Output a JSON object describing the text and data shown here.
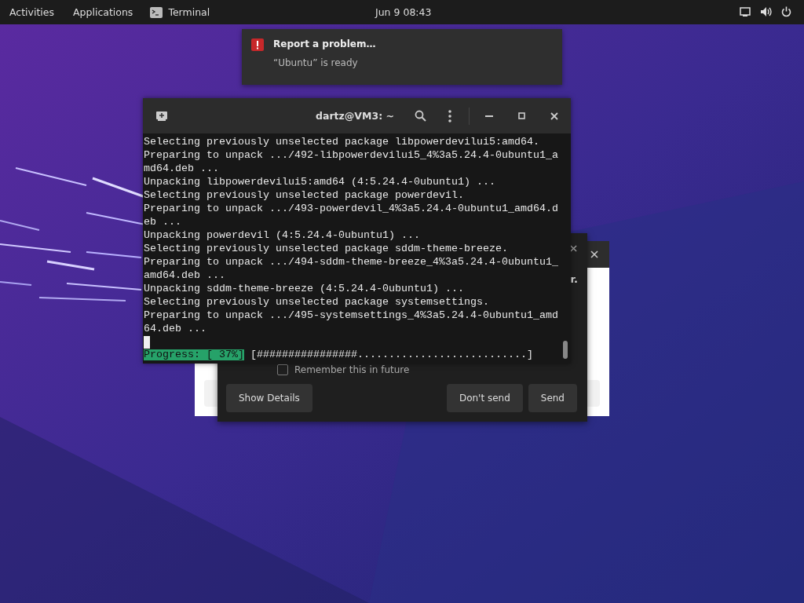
{
  "top_bar": {
    "activities": "Activities",
    "applications": "Applications",
    "app_name": "Terminal",
    "clock": "Jun 9  08:43"
  },
  "notification": {
    "title": "Report a problem…",
    "body": "“Ubuntu” is ready"
  },
  "background_dialog": {
    "text_fragment": "r.",
    "checkbox": {
      "label": "Remember this in future",
      "checked": false
    },
    "buttons": [
      {
        "label": "Show Details",
        "kind": "left"
      },
      {
        "label": "Don't send",
        "kind": "right"
      },
      {
        "label": "Send",
        "kind": "right"
      }
    ]
  },
  "terminal": {
    "title": "dartz@VM3: ~",
    "lines": [
      "Selecting previously unselected package libpowerdevilui5:amd64.",
      "Preparing to unpack .../492-libpowerdevilui5_4%3a5.24.4-0ubuntu1_a",
      "md64.deb ...",
      "Unpacking libpowerdevilui5:amd64 (4:5.24.4-0ubuntu1) ...",
      "Selecting previously unselected package powerdevil.",
      "Preparing to unpack .../493-powerdevil_4%3a5.24.4-0ubuntu1_amd64.d",
      "eb ...",
      "Unpacking powerdevil (4:5.24.4-0ubuntu1) ...",
      "Selecting previously unselected package sddm-theme-breeze.",
      "Preparing to unpack .../494-sddm-theme-breeze_4%3a5.24.4-0ubuntu1_",
      "amd64.deb ...",
      "Unpacking sddm-theme-breeze (4:5.24.4-0ubuntu1) ...",
      "Selecting previously unselected package systemsettings.",
      "Preparing to unpack .../495-systemsettings_4%3a5.24.4-0ubuntu1_amd",
      "64.deb ..."
    ],
    "progress_label": "Progress: [ 37%]",
    "progress_bar": "[################...........................]"
  }
}
